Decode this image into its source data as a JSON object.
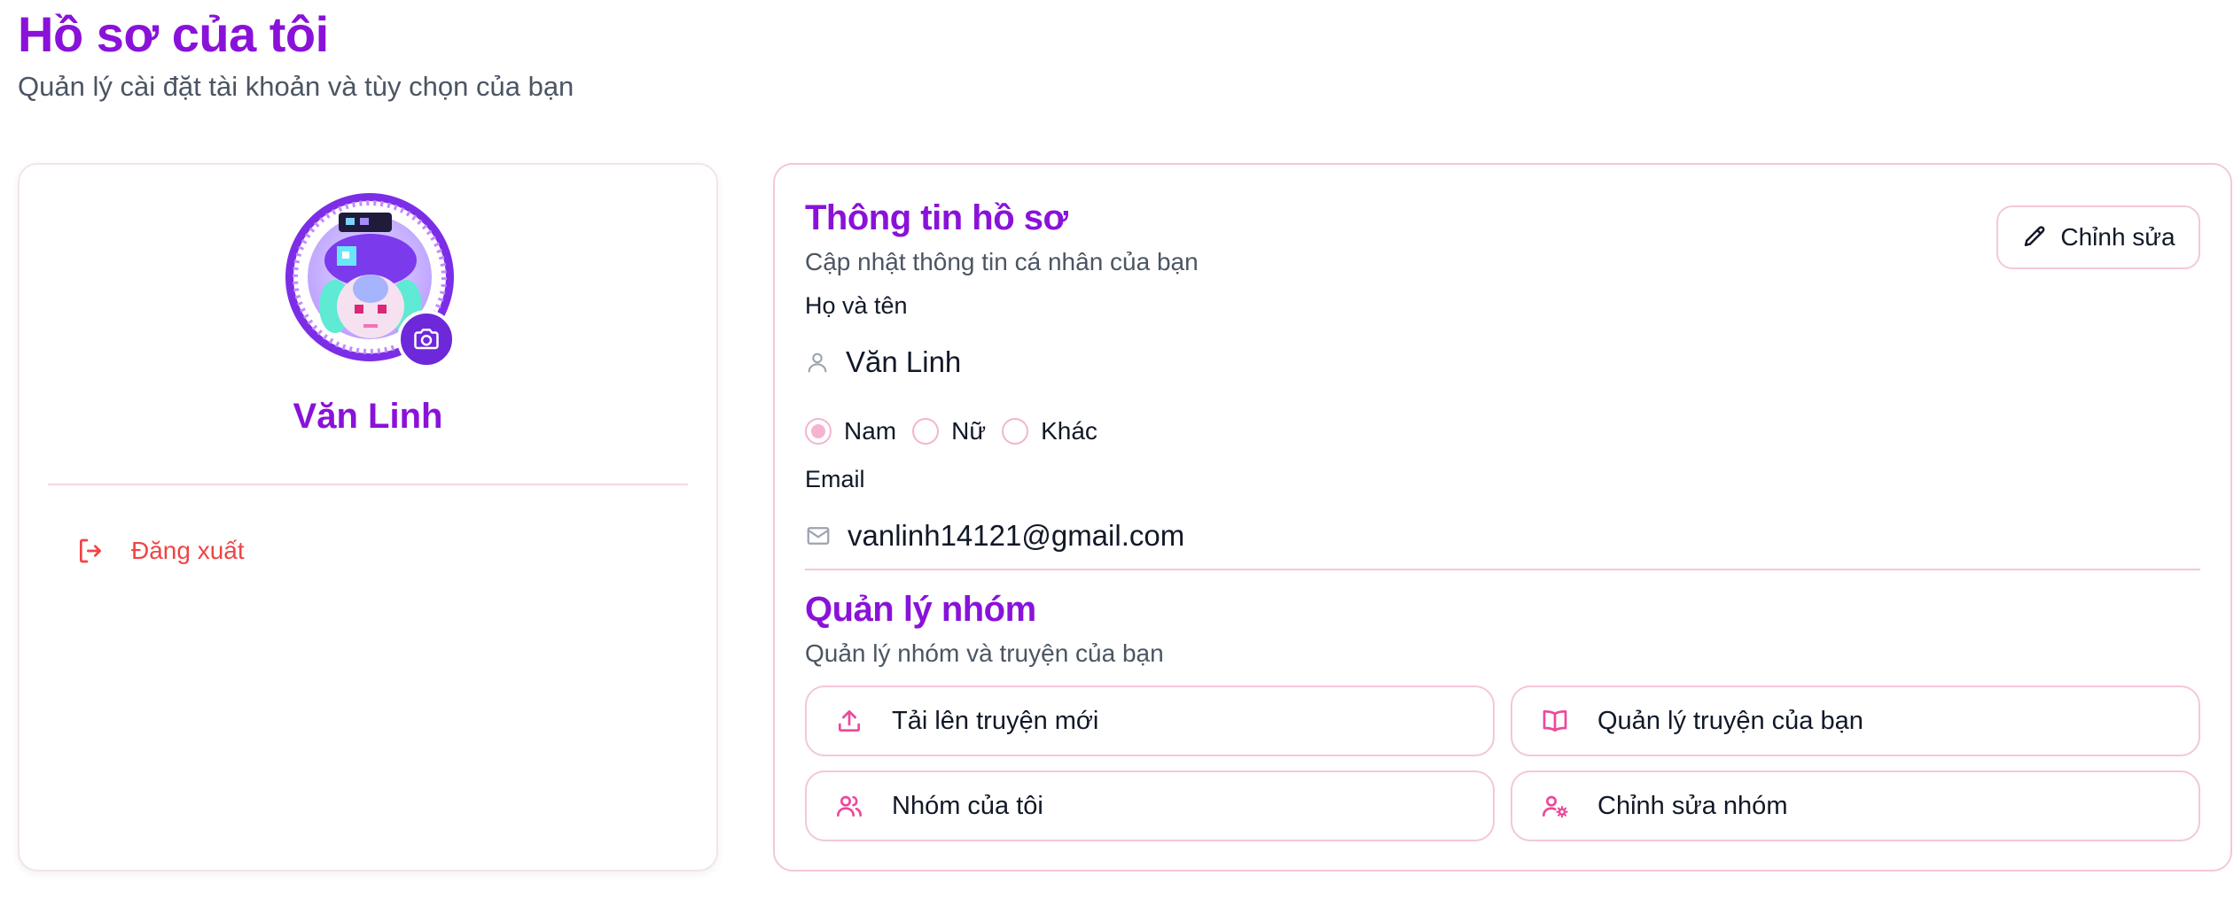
{
  "page": {
    "title": "Hồ sơ của tôi",
    "subtitle": "Quản lý cài đặt tài khoản và tùy chọn của bạn"
  },
  "profile_card": {
    "avatar_icon": "avatar-image",
    "camera_icon": "camera-icon",
    "user_name": "Văn Linh",
    "logout_label": "Đăng xuất",
    "logout_icon": "logout-icon"
  },
  "profile_info": {
    "title": "Thông tin hồ sơ",
    "subtitle": "Cập nhật thông tin cá nhân của bạn",
    "edit_label": "Chỉnh sửa",
    "name_label": "Họ và tên",
    "name_value": "Văn Linh",
    "gender_options": [
      {
        "label": "Nam",
        "checked": true
      },
      {
        "label": "Nữ",
        "checked": false
      },
      {
        "label": "Khác",
        "checked": false
      }
    ],
    "email_label": "Email",
    "email_value": "vanlinh14121@gmail.com"
  },
  "group_management": {
    "title": "Quản lý nhóm",
    "subtitle": "Quản lý nhóm và truyện của bạn",
    "actions": [
      {
        "label": "Tải lên truyện mới",
        "icon": "upload-icon"
      },
      {
        "label": "Quản lý truyện của bạn",
        "icon": "book-open-icon"
      },
      {
        "label": "Nhóm của tôi",
        "icon": "users-icon"
      },
      {
        "label": "Chỉnh sửa nhóm",
        "icon": "user-cog-icon"
      }
    ]
  },
  "colors": {
    "brand_purple": "#8a12d8",
    "accent_pink": "#ec4899",
    "border_pink": "#f4c6dc",
    "danger_red": "#ef4444",
    "camera_purple": "#6d28d9"
  }
}
